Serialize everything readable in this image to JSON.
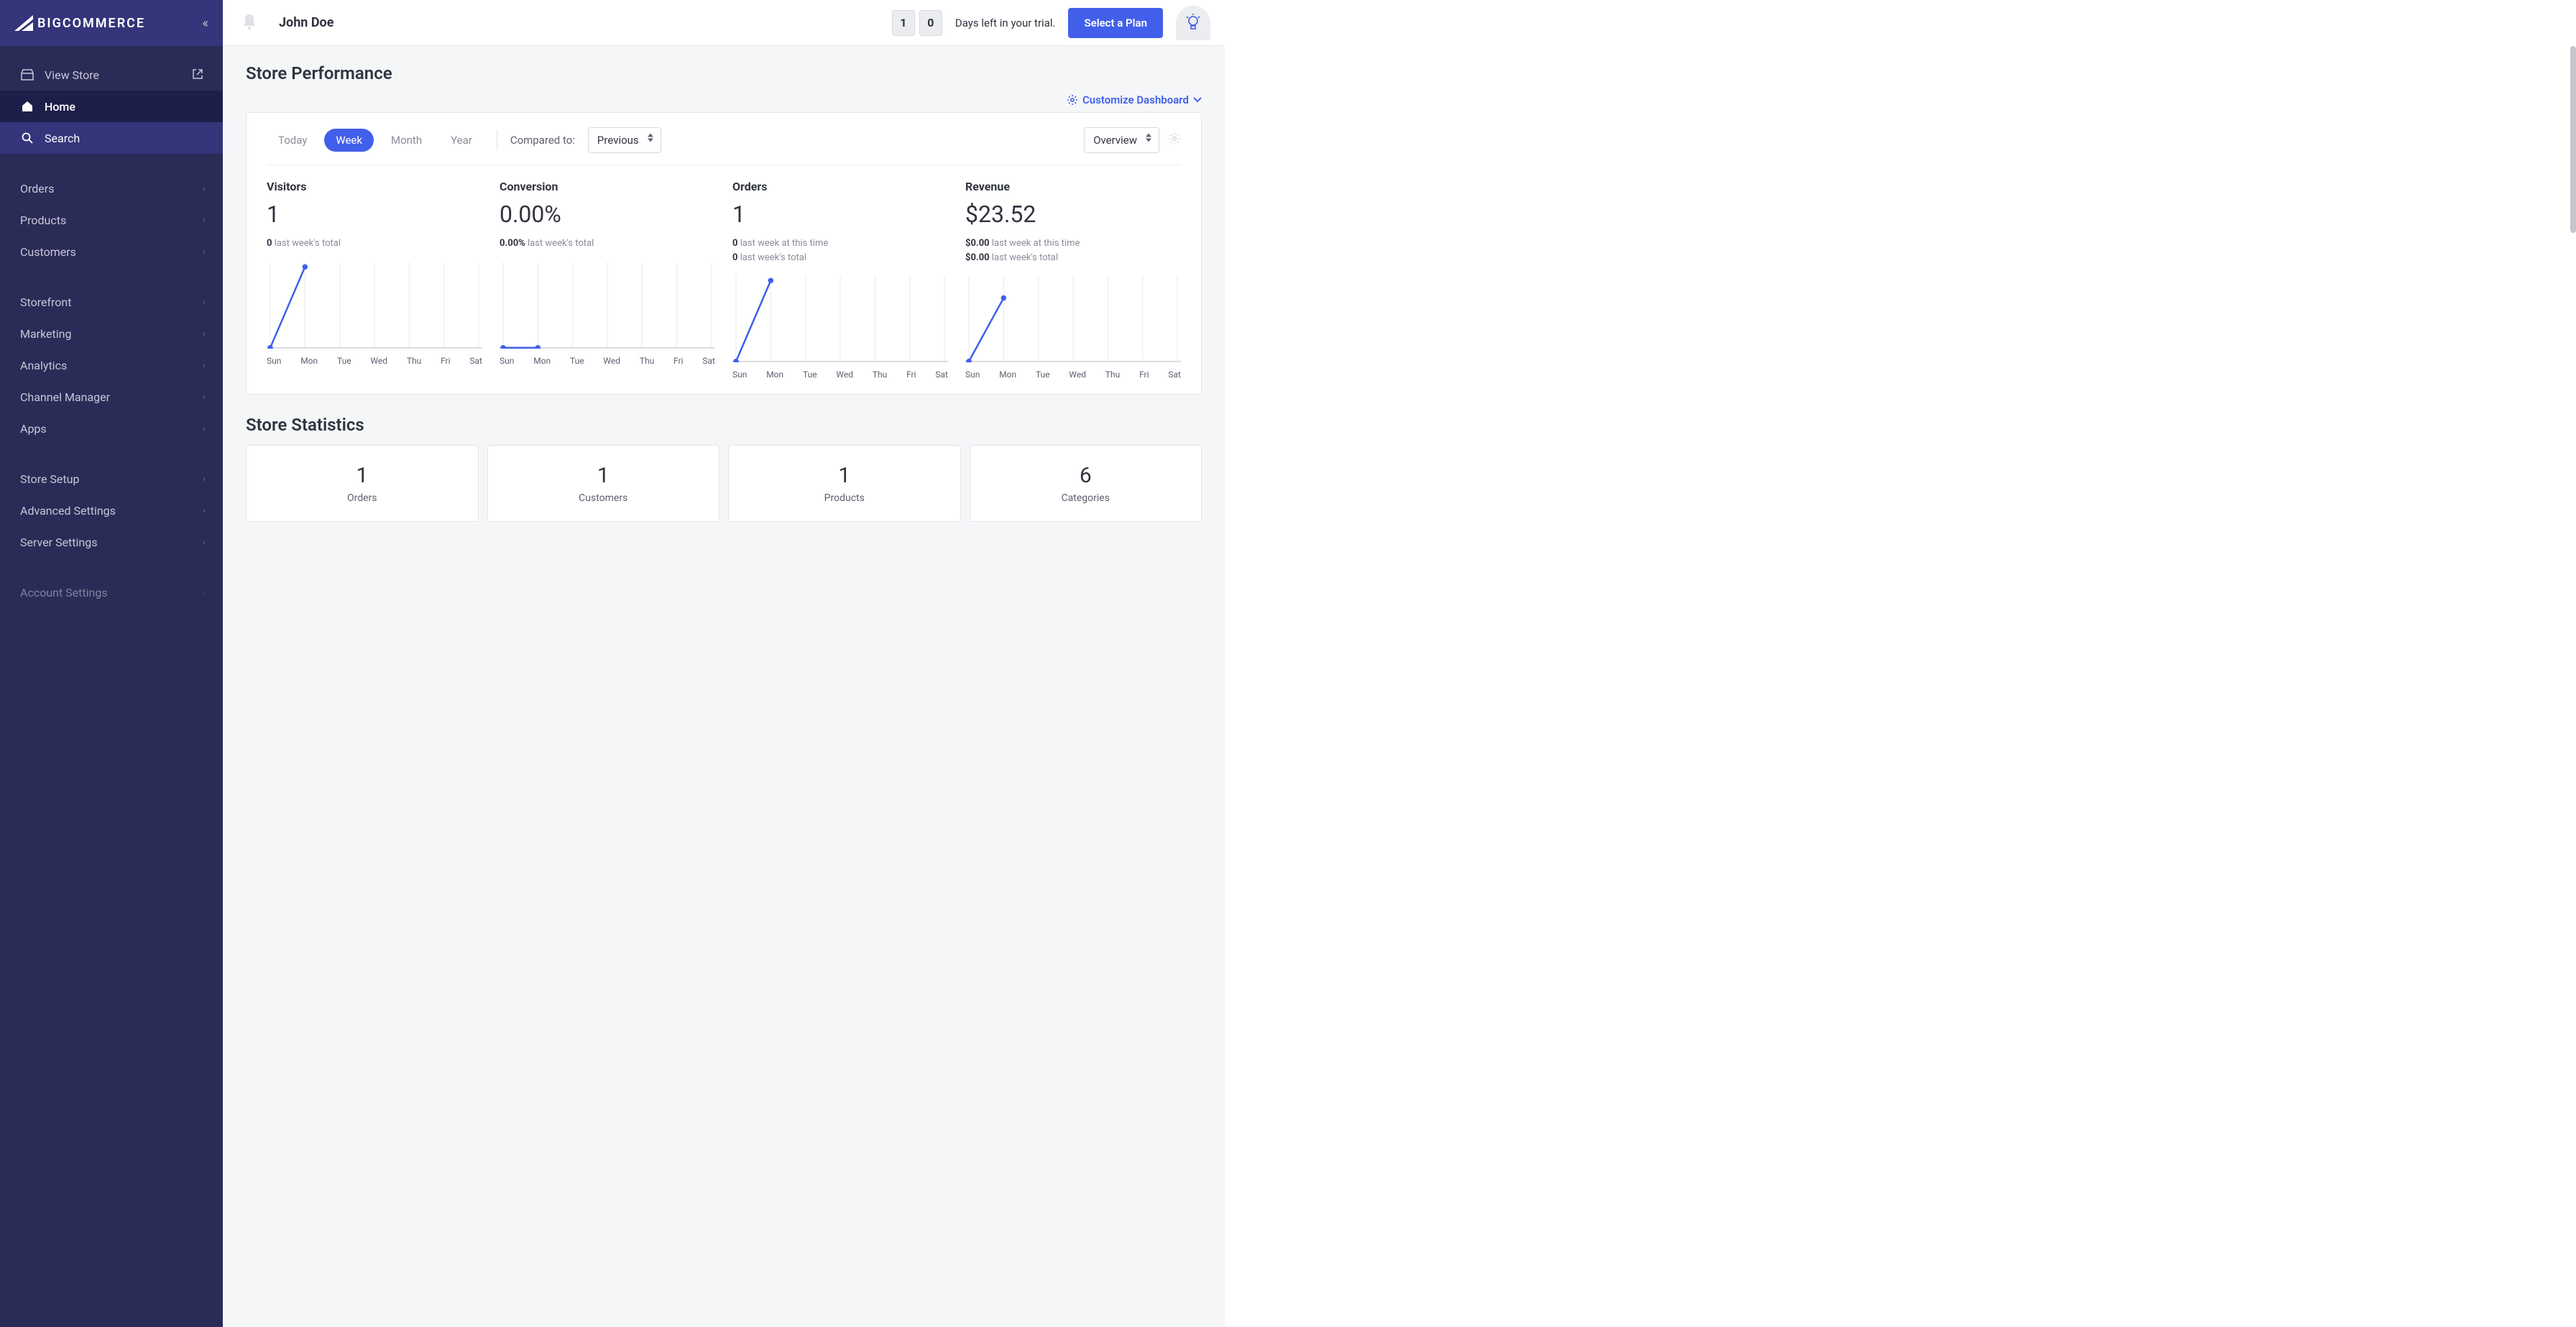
{
  "brand": {
    "name": "BIGCOMMERCE"
  },
  "sidebar": {
    "view_store": "View Store",
    "home": "Home",
    "search": "Search",
    "group1": [
      "Orders",
      "Products",
      "Customers"
    ],
    "group2": [
      "Storefront",
      "Marketing",
      "Analytics",
      "Channel Manager",
      "Apps"
    ],
    "group3": [
      "Store Setup",
      "Advanced Settings",
      "Server Settings"
    ],
    "group4": [
      "Account Settings"
    ]
  },
  "topbar": {
    "username": "John Doe",
    "trial_digits": [
      "1",
      "0"
    ],
    "trial_text": "Days left in your trial.",
    "select_plan": "Select a Plan"
  },
  "performance": {
    "title": "Store Performance",
    "customize": "Customize Dashboard",
    "ranges": [
      "Today",
      "Week",
      "Month",
      "Year"
    ],
    "active_range_index": 1,
    "compared_label": "Compared to:",
    "compared_value": "Previous",
    "overview_value": "Overview",
    "days": [
      "Sun",
      "Mon",
      "Tue",
      "Wed",
      "Thu",
      "Fri",
      "Sat"
    ],
    "metrics": [
      {
        "title": "Visitors",
        "value": "1",
        "subs": [
          {
            "b": "0",
            "t": " last week's total"
          }
        ]
      },
      {
        "title": "Conversion",
        "value": "0.00%",
        "subs": [
          {
            "b": "0.00%",
            "t": " last week's total"
          }
        ]
      },
      {
        "title": "Orders",
        "value": "1",
        "subs": [
          {
            "b": "0",
            "t": " last week at this time"
          },
          {
            "b": "0",
            "t": " last week's total"
          }
        ]
      },
      {
        "title": "Revenue",
        "value": "$23.52",
        "subs": [
          {
            "b": "$0.00",
            "t": " last week at this time"
          },
          {
            "b": "$0.00",
            "t": " last week's total"
          }
        ]
      }
    ]
  },
  "statistics": {
    "title": "Store Statistics",
    "cards": [
      {
        "value": "1",
        "label": "Orders"
      },
      {
        "value": "1",
        "label": "Customers"
      },
      {
        "value": "1",
        "label": "Products"
      },
      {
        "value": "6",
        "label": "Categories"
      }
    ]
  },
  "chart_data": [
    {
      "type": "line",
      "title": "Visitors",
      "categories": [
        "Sun",
        "Mon",
        "Tue",
        "Wed",
        "Thu",
        "Fri",
        "Sat"
      ],
      "values": [
        0,
        1,
        null,
        null,
        null,
        null,
        null
      ],
      "ylim": [
        0,
        1
      ]
    },
    {
      "type": "line",
      "title": "Conversion",
      "categories": [
        "Sun",
        "Mon",
        "Tue",
        "Wed",
        "Thu",
        "Fri",
        "Sat"
      ],
      "values": [
        0,
        0,
        null,
        null,
        null,
        null,
        null
      ],
      "ylim": [
        0,
        1
      ]
    },
    {
      "type": "line",
      "title": "Orders",
      "categories": [
        "Sun",
        "Mon",
        "Tue",
        "Wed",
        "Thu",
        "Fri",
        "Sat"
      ],
      "values": [
        0,
        1,
        null,
        null,
        null,
        null,
        null
      ],
      "ylim": [
        0,
        1
      ]
    },
    {
      "type": "line",
      "title": "Revenue",
      "categories": [
        "Sun",
        "Mon",
        "Tue",
        "Wed",
        "Thu",
        "Fri",
        "Sat"
      ],
      "values": [
        0,
        23.52,
        null,
        null,
        null,
        null,
        null
      ],
      "ylim": [
        0,
        30
      ]
    }
  ]
}
